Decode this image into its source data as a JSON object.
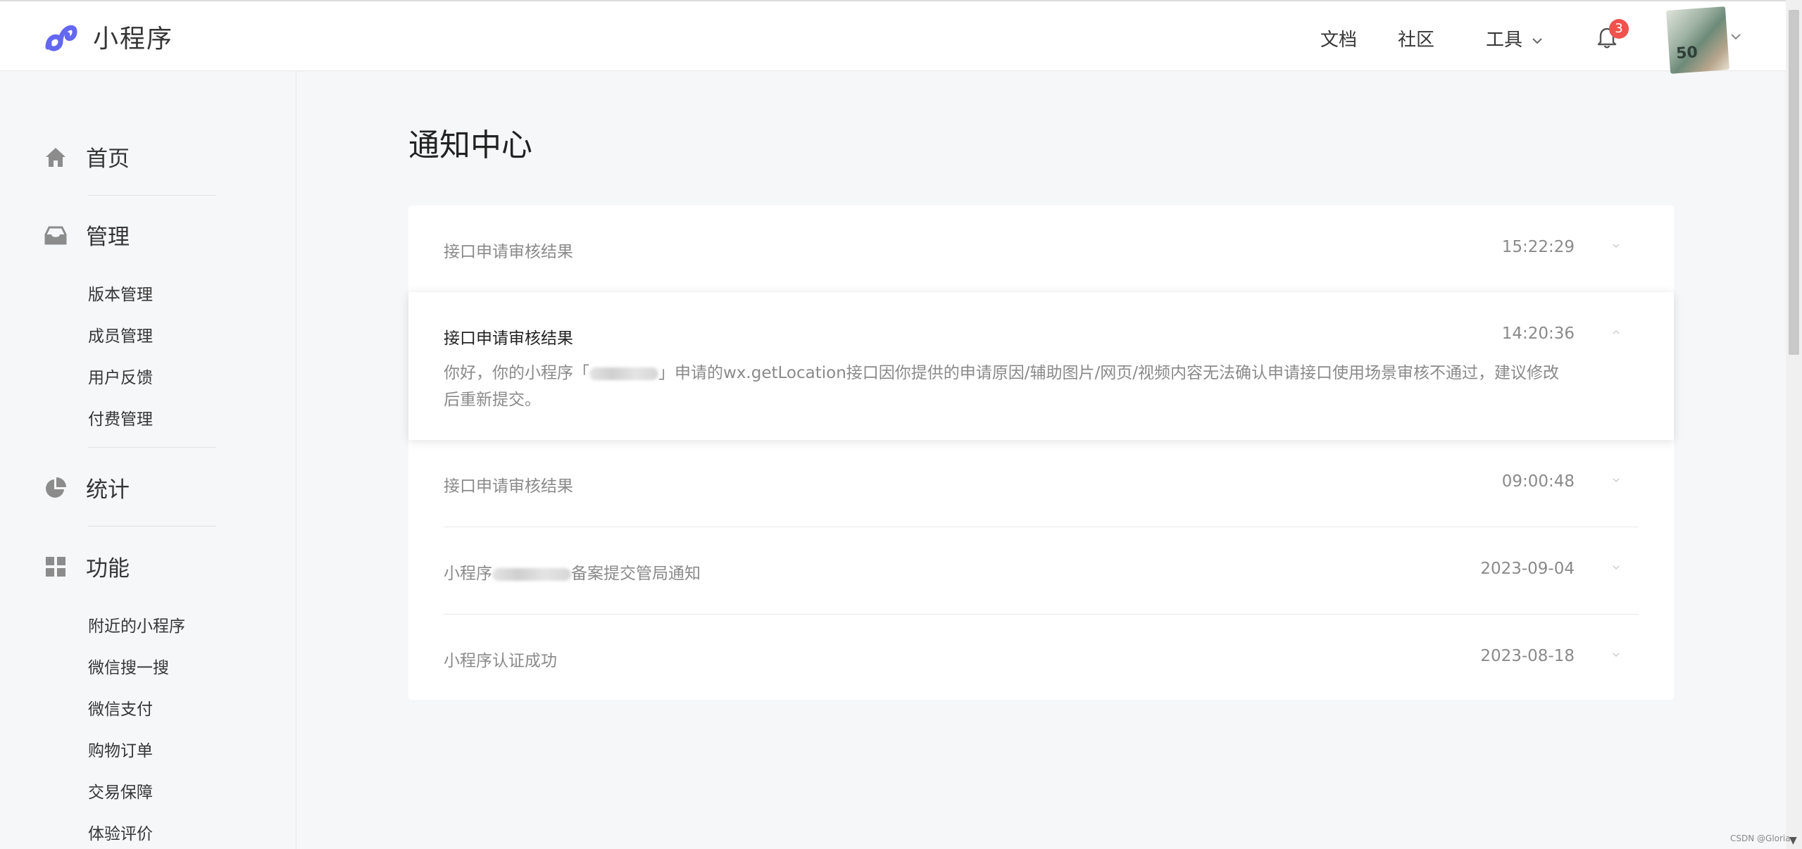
{
  "header": {
    "logo_text": "小程序",
    "nav": {
      "docs": "文档",
      "community": "社区",
      "tools": "工具"
    },
    "notification_count": "3",
    "avatar_text": "50"
  },
  "sidebar": {
    "home": "首页",
    "manage": "管理",
    "manage_items": [
      "版本管理",
      "成员管理",
      "用户反馈",
      "付费管理"
    ],
    "stats": "统计",
    "features": "功能",
    "feature_items": [
      "附近的小程序",
      "微信搜一搜",
      "微信支付",
      "购物订单",
      "交易保障",
      "体验评价"
    ]
  },
  "main": {
    "page_title": "通知中心",
    "notifications": [
      {
        "title": "接口申请审核结果",
        "time": "15:22:29"
      },
      {
        "title": "接口申请审核结果",
        "time": "14:20:36",
        "body_prefix": "你好，你的小程序「",
        "body_suffix": "」申请的wx.getLocation接口因你提供的申请原因/辅助图片/网页/视频内容无法确认申请接口使用场景审核不通过，建议修改后重新提交。"
      },
      {
        "title": "接口申请审核结果",
        "time": "09:00:48"
      },
      {
        "title_prefix": "小程序",
        "title_suffix": "备案提交管局通知",
        "time": "2023-09-04"
      },
      {
        "title": "小程序认证成功",
        "time": "2023-08-18"
      }
    ]
  },
  "watermark": "CSDN @Gloria",
  "colors": {
    "accent": "#6467f0",
    "badge": "#f0524d"
  }
}
